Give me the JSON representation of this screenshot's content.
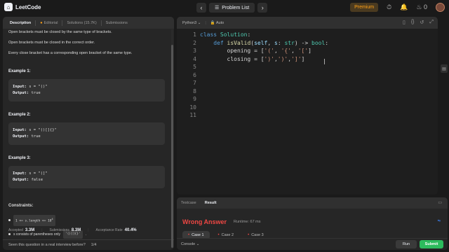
{
  "topbar": {
    "logo_text": "LeetCode",
    "problem_list": "Problem List",
    "premium": "Premium",
    "streak": "0"
  },
  "left": {
    "tabs": [
      "Description",
      "Editorial",
      "Solutions (15.7K)",
      "Submissions"
    ],
    "lines": [
      "Open brackets must be closed by the same type of brackets.",
      "Open brackets must be closed in the correct order.",
      "Every close bracket has a corresponding open bracket of the same type."
    ],
    "examples": [
      {
        "title": "Example 1:",
        "input": "s = \"()\"",
        "output": "true"
      },
      {
        "title": "Example 2:",
        "input": "s = \"()[]{}\"",
        "output": "true"
      },
      {
        "title": "Example 3:",
        "input": "s = \"(]\"",
        "output": "false"
      }
    ],
    "input_label": "Input:",
    "output_label": "Output:",
    "constraints_title": "Constraints:",
    "constraint1": "1 <= s.length <= 10",
    "constraint1_exp": "4",
    "constraint2_pre": "s consists of parentheses only",
    "constraint2_code": "'()[]{}'",
    "constraint2_post": ".",
    "stats": [
      {
        "label": "Accepted",
        "value": "3.3M"
      },
      {
        "label": "Submissions",
        "value": "8.3M"
      },
      {
        "label": "Acceptance Rate",
        "value": "40.4%"
      }
    ],
    "seen_text": "Seen this question in a real interview before?",
    "seen_count": "1/4"
  },
  "editor": {
    "language": "Python3",
    "mode": "Auto",
    "line_numbers": [
      "1",
      "2",
      "3",
      "4",
      "5",
      "6",
      "7",
      "8",
      "9",
      "10",
      "11"
    ]
  },
  "result": {
    "tabs": [
      "Testcase",
      "Result"
    ],
    "status": "Wrong Answer",
    "runtime": "Runtime: 67 ms",
    "cases": [
      "Case 1",
      "Case 2",
      "Case 3"
    ],
    "console": "Console",
    "run": "Run",
    "submit": "Submit"
  }
}
